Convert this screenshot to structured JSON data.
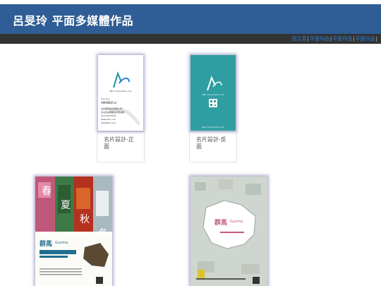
{
  "header": {
    "title": "呂旻玲 平面多媒體作品"
  },
  "nav": {
    "items": [
      {
        "label": "回主頁"
      },
      {
        "label": "平面作品"
      },
      {
        "label": "平面作品"
      },
      {
        "label": "平面作品"
      }
    ]
  },
  "gallery": {
    "items": [
      {
        "label": "名片設計-正面",
        "card": {
          "company": "ABC Corporation Ltd.",
          "role": "Manager",
          "name": "AMANDA LI",
          "lines": [
            "某某國際股份有限公司",
            "台北市某某路某某號某樓",
            "02-1234-5678",
            "www.abc.com",
            "abc@abc.com"
          ]
        }
      },
      {
        "label": "名片設計-反面",
        "card": {
          "company": "ABC Corporation Ltd.",
          "footer": "ABC Corporation Ltd."
        }
      },
      {
        "label": "",
        "poster": {
          "brand": "群馬",
          "brand_en": "Gunma",
          "season_chars": [
            "春",
            "夏",
            "秋",
            "冬"
          ]
        }
      },
      {
        "label": "",
        "poster": {
          "brand": "群馬",
          "brand_en": "Gunma"
        }
      }
    ]
  },
  "colors": {
    "header": "#2f5d95",
    "navbar": "#333333",
    "link": "#2f7fd8",
    "teal": "#2f9ea2"
  }
}
